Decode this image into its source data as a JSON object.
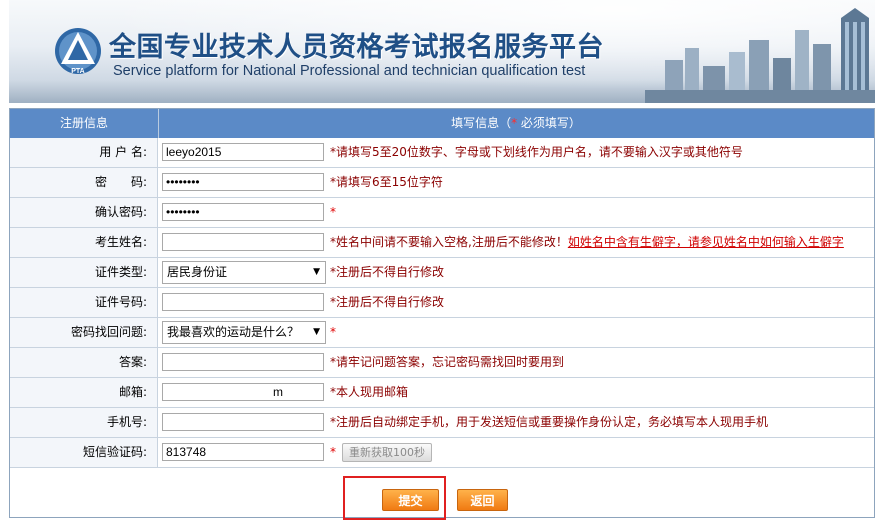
{
  "banner": {
    "title_cn": "全国专业技术人员资格考试报名服务平台",
    "title_en": "Service platform for National Professional and technician  qualification test",
    "logo_text": "PTA"
  },
  "table_header": {
    "col1": "注册信息",
    "col2_prefix": "填写信息（",
    "col2_star": "*",
    "col2_suffix": " 必须填写）"
  },
  "fields": [
    {
      "label": "用 户 名:",
      "value": "leeyo2015",
      "hint": "*请填写5至20位数字、字母或下划线作为用户名，请不要输入汉字或其他符号"
    },
    {
      "label": "密　　码:",
      "value": "••••••••",
      "hint": "*请填写6至15位字符"
    },
    {
      "label": "确认密码:",
      "value": "••••••••",
      "hint": "*"
    },
    {
      "label": "考生姓名:",
      "value": "",
      "hint": "*姓名中间请不要输入空格,注册后不能修改！",
      "hint_link": "如姓名中含有生僻字，请参见姓名中如何输入生僻字"
    },
    {
      "label": "证件类型:",
      "value": "居民身份证",
      "hint": "*注册后不得自行修改"
    },
    {
      "label": "证件号码:",
      "value": "",
      "hint": "*注册后不得自行修改"
    },
    {
      "label": "密码找回问题:",
      "value": "我最喜欢的运动是什么？",
      "hint": "*"
    },
    {
      "label": "答案:",
      "value": "",
      "hint": "*请牢记问题答案，忘记密码需找回时要用到"
    },
    {
      "label": "邮箱:",
      "value": "m",
      "hint": "*本人现用邮箱"
    },
    {
      "label": "手机号:",
      "value": "",
      "hint": "*注册后自动绑定手机，用于发送短信或重要操作身份认定，务必填写本人现用手机"
    },
    {
      "label": "短信验证码:",
      "value": "813748",
      "hint": "*",
      "button": "重新获取100秒"
    }
  ],
  "buttons": {
    "submit": "提交",
    "back": "返回"
  },
  "colors": {
    "header_bg": "#5b8ac7",
    "hint_text": "#8b0000",
    "button_orange": "#f07a12",
    "highlight_box": "#e02020"
  }
}
